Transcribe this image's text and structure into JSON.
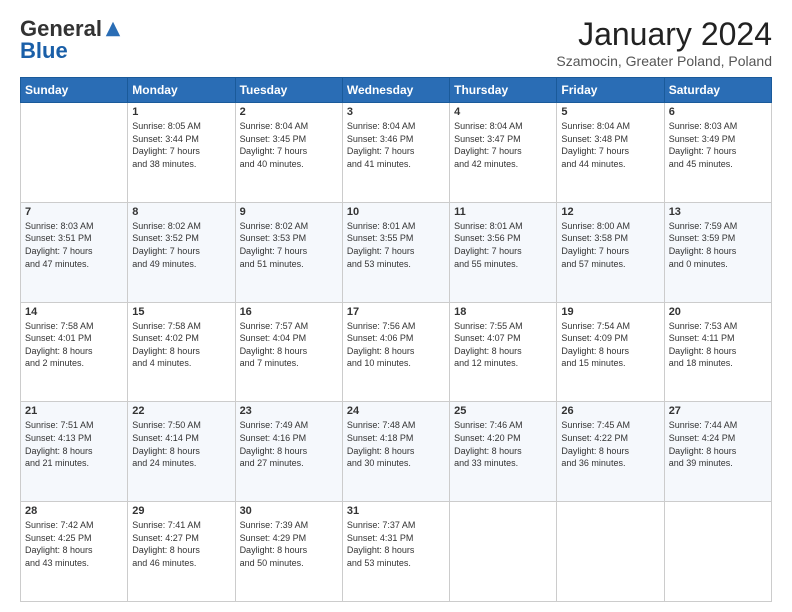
{
  "logo": {
    "general": "General",
    "blue": "Blue"
  },
  "header": {
    "month": "January 2024",
    "location": "Szamocin, Greater Poland, Poland"
  },
  "weekdays": [
    "Sunday",
    "Monday",
    "Tuesday",
    "Wednesday",
    "Thursday",
    "Friday",
    "Saturday"
  ],
  "weeks": [
    [
      {
        "day": "",
        "info": ""
      },
      {
        "day": "1",
        "info": "Sunrise: 8:05 AM\nSunset: 3:44 PM\nDaylight: 7 hours\nand 38 minutes."
      },
      {
        "day": "2",
        "info": "Sunrise: 8:04 AM\nSunset: 3:45 PM\nDaylight: 7 hours\nand 40 minutes."
      },
      {
        "day": "3",
        "info": "Sunrise: 8:04 AM\nSunset: 3:46 PM\nDaylight: 7 hours\nand 41 minutes."
      },
      {
        "day": "4",
        "info": "Sunrise: 8:04 AM\nSunset: 3:47 PM\nDaylight: 7 hours\nand 42 minutes."
      },
      {
        "day": "5",
        "info": "Sunrise: 8:04 AM\nSunset: 3:48 PM\nDaylight: 7 hours\nand 44 minutes."
      },
      {
        "day": "6",
        "info": "Sunrise: 8:03 AM\nSunset: 3:49 PM\nDaylight: 7 hours\nand 45 minutes."
      }
    ],
    [
      {
        "day": "7",
        "info": "Sunrise: 8:03 AM\nSunset: 3:51 PM\nDaylight: 7 hours\nand 47 minutes."
      },
      {
        "day": "8",
        "info": "Sunrise: 8:02 AM\nSunset: 3:52 PM\nDaylight: 7 hours\nand 49 minutes."
      },
      {
        "day": "9",
        "info": "Sunrise: 8:02 AM\nSunset: 3:53 PM\nDaylight: 7 hours\nand 51 minutes."
      },
      {
        "day": "10",
        "info": "Sunrise: 8:01 AM\nSunset: 3:55 PM\nDaylight: 7 hours\nand 53 minutes."
      },
      {
        "day": "11",
        "info": "Sunrise: 8:01 AM\nSunset: 3:56 PM\nDaylight: 7 hours\nand 55 minutes."
      },
      {
        "day": "12",
        "info": "Sunrise: 8:00 AM\nSunset: 3:58 PM\nDaylight: 7 hours\nand 57 minutes."
      },
      {
        "day": "13",
        "info": "Sunrise: 7:59 AM\nSunset: 3:59 PM\nDaylight: 8 hours\nand 0 minutes."
      }
    ],
    [
      {
        "day": "14",
        "info": "Sunrise: 7:58 AM\nSunset: 4:01 PM\nDaylight: 8 hours\nand 2 minutes."
      },
      {
        "day": "15",
        "info": "Sunrise: 7:58 AM\nSunset: 4:02 PM\nDaylight: 8 hours\nand 4 minutes."
      },
      {
        "day": "16",
        "info": "Sunrise: 7:57 AM\nSunset: 4:04 PM\nDaylight: 8 hours\nand 7 minutes."
      },
      {
        "day": "17",
        "info": "Sunrise: 7:56 AM\nSunset: 4:06 PM\nDaylight: 8 hours\nand 10 minutes."
      },
      {
        "day": "18",
        "info": "Sunrise: 7:55 AM\nSunset: 4:07 PM\nDaylight: 8 hours\nand 12 minutes."
      },
      {
        "day": "19",
        "info": "Sunrise: 7:54 AM\nSunset: 4:09 PM\nDaylight: 8 hours\nand 15 minutes."
      },
      {
        "day": "20",
        "info": "Sunrise: 7:53 AM\nSunset: 4:11 PM\nDaylight: 8 hours\nand 18 minutes."
      }
    ],
    [
      {
        "day": "21",
        "info": "Sunrise: 7:51 AM\nSunset: 4:13 PM\nDaylight: 8 hours\nand 21 minutes."
      },
      {
        "day": "22",
        "info": "Sunrise: 7:50 AM\nSunset: 4:14 PM\nDaylight: 8 hours\nand 24 minutes."
      },
      {
        "day": "23",
        "info": "Sunrise: 7:49 AM\nSunset: 4:16 PM\nDaylight: 8 hours\nand 27 minutes."
      },
      {
        "day": "24",
        "info": "Sunrise: 7:48 AM\nSunset: 4:18 PM\nDaylight: 8 hours\nand 30 minutes."
      },
      {
        "day": "25",
        "info": "Sunrise: 7:46 AM\nSunset: 4:20 PM\nDaylight: 8 hours\nand 33 minutes."
      },
      {
        "day": "26",
        "info": "Sunrise: 7:45 AM\nSunset: 4:22 PM\nDaylight: 8 hours\nand 36 minutes."
      },
      {
        "day": "27",
        "info": "Sunrise: 7:44 AM\nSunset: 4:24 PM\nDaylight: 8 hours\nand 39 minutes."
      }
    ],
    [
      {
        "day": "28",
        "info": "Sunrise: 7:42 AM\nSunset: 4:25 PM\nDaylight: 8 hours\nand 43 minutes."
      },
      {
        "day": "29",
        "info": "Sunrise: 7:41 AM\nSunset: 4:27 PM\nDaylight: 8 hours\nand 46 minutes."
      },
      {
        "day": "30",
        "info": "Sunrise: 7:39 AM\nSunset: 4:29 PM\nDaylight: 8 hours\nand 50 minutes."
      },
      {
        "day": "31",
        "info": "Sunrise: 7:37 AM\nSunset: 4:31 PM\nDaylight: 8 hours\nand 53 minutes."
      },
      {
        "day": "",
        "info": ""
      },
      {
        "day": "",
        "info": ""
      },
      {
        "day": "",
        "info": ""
      }
    ]
  ]
}
